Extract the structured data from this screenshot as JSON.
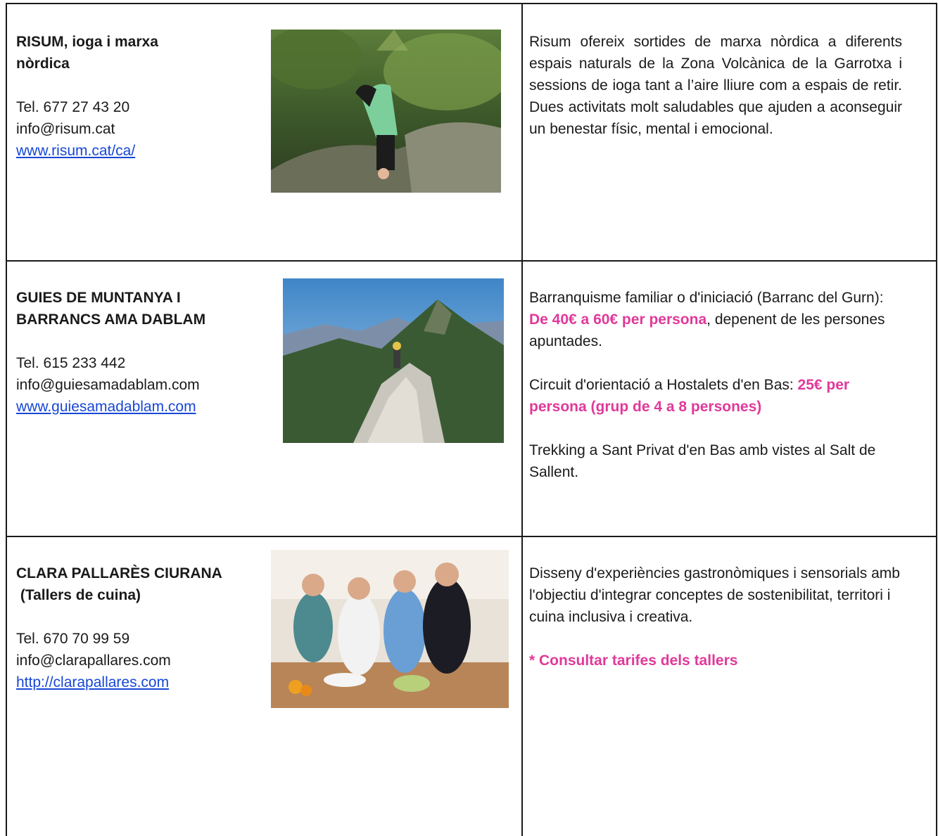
{
  "rows": [
    {
      "name_lines": [
        "RISUM, ioga i marxa",
        "nòrdica"
      ],
      "tel": "Tel. 677 27 43 20",
      "email": "info@risum.cat",
      "web": "www.risum.cat/ca/",
      "photo_icon": "yoga-photo",
      "description": "Risum ofereix sortides de marxa nòrdica a diferents espais naturals de la Zona Volcànica de la Garrotxa i sessions de ioga tant a l’aire lliure com a espais de retir. Dues activitats molt saludables que ajuden a aconseguir un benestar físic, mental i emocional."
    },
    {
      "name_lines": [
        "GUIES DE MUNTANYA I",
        "BARRANCS AMA DABLAM"
      ],
      "tel": "Tel. 615 233 442",
      "email": "info@guiesamadablam.com",
      "web": "www.guiesamadablam.com",
      "photo_icon": "mountain-photo",
      "desc1_a": "Barranquisme familiar o d'iniciació (Barranc del Gurn): ",
      "desc1_price": "De 40€ a 60€ per persona",
      "desc1_b": ", depenent de les persones apuntades.",
      "desc2_a": "Circuit d'orientació a Hostalets d'en Bas: ",
      "desc2_price": "25€ per persona (grup de 4 a 8 persones)",
      "desc3": "Trekking a Sant Privat d'en Bas amb vistes al Salt de Sallent."
    },
    {
      "name_lines": [
        "CLARA PALLARÈS CIURANA",
        " (Tallers de cuina)"
      ],
      "tel": "Tel. 670 70 99 59",
      "email": "info@clarapallares.com",
      "web": "http://clarapallares.com",
      "photo_icon": "cooking-photo",
      "description": "Disseny d'experiències gastronòmiques i sensorials amb l'objectiu d'integrar conceptes de sostenibilitat, territori i cuina inclusiva i creativa.",
      "note": "* Consultar tarifes dels tallers"
    }
  ],
  "colors": {
    "link": "#1747d6",
    "price": "#e0399a",
    "border": "#1a1a1a"
  }
}
